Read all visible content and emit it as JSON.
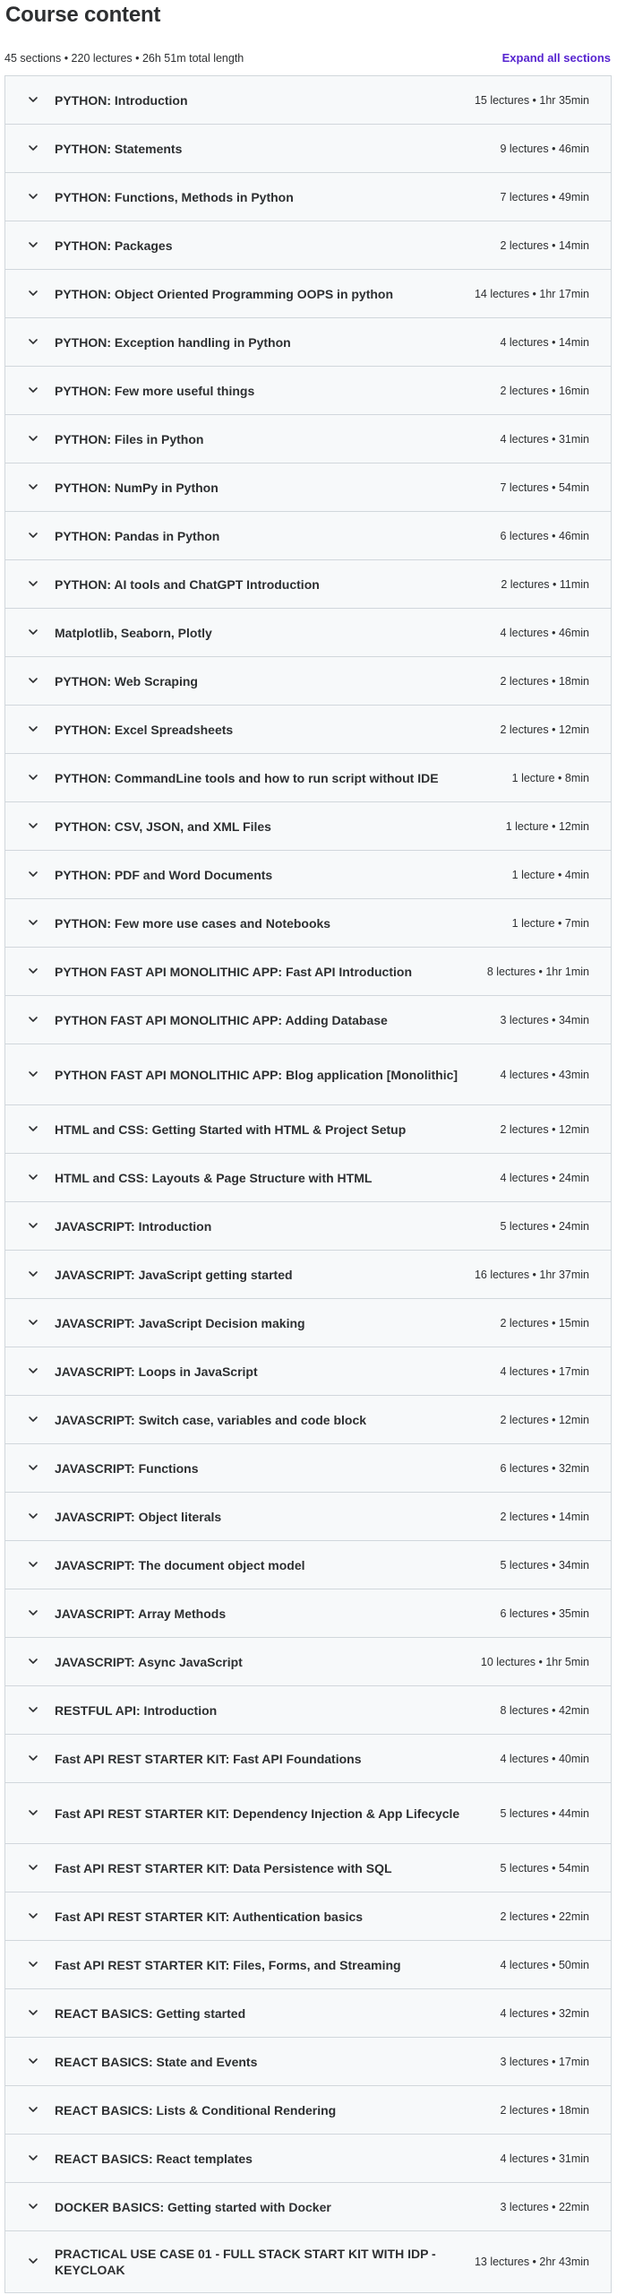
{
  "header": {
    "title": "Course content",
    "summary": "45 sections • 220 lectures • 26h 51m total length",
    "expand_label": "Expand all sections"
  },
  "sections": [
    {
      "title": "PYTHON: Introduction",
      "meta": "15 lectures • 1hr 35min"
    },
    {
      "title": "PYTHON: Statements",
      "meta": "9 lectures • 46min"
    },
    {
      "title": "PYTHON: Functions, Methods in Python",
      "meta": "7 lectures • 49min"
    },
    {
      "title": "PYTHON: Packages",
      "meta": "2 lectures • 14min"
    },
    {
      "title": "PYTHON: Object Oriented Programming OOPS in python",
      "meta": "14 lectures • 1hr 17min"
    },
    {
      "title": "PYTHON: Exception handling in Python",
      "meta": "4 lectures • 14min"
    },
    {
      "title": "PYTHON: Few more useful things",
      "meta": "2 lectures • 16min"
    },
    {
      "title": "PYTHON: Files in Python",
      "meta": "4 lectures • 31min"
    },
    {
      "title": "PYTHON: NumPy in Python",
      "meta": "7 lectures • 54min"
    },
    {
      "title": "PYTHON: Pandas in Python",
      "meta": "6 lectures • 46min"
    },
    {
      "title": "PYTHON: AI tools and ChatGPT Introduction",
      "meta": "2 lectures • 11min"
    },
    {
      "title": "Matplotlib, Seaborn, Plotly",
      "meta": "4 lectures • 46min"
    },
    {
      "title": "PYTHON: Web Scraping",
      "meta": "2 lectures • 18min"
    },
    {
      "title": "PYTHON: Excel Spreadsheets",
      "meta": "2 lectures • 12min"
    },
    {
      "title": "PYTHON: CommandLine tools and how to run script without IDE",
      "meta": "1 lecture • 8min"
    },
    {
      "title": "PYTHON: CSV, JSON, and XML Files",
      "meta": "1 lecture • 12min"
    },
    {
      "title": "PYTHON: PDF and Word Documents",
      "meta": "1 lecture • 4min"
    },
    {
      "title": "PYTHON: Few more use cases and Notebooks",
      "meta": "1 lecture • 7min"
    },
    {
      "title": "PYTHON FAST API MONOLITHIC APP: Fast API Introduction",
      "meta": "8 lectures • 1hr 1min"
    },
    {
      "title": "PYTHON FAST API MONOLITHIC APP: Adding Database",
      "meta": "3 lectures • 34min"
    },
    {
      "title": "PYTHON FAST API MONOLITHIC APP: Blog application [Monolithic]",
      "meta": "4 lectures • 43min"
    },
    {
      "title": "HTML and CSS: Getting Started with HTML & Project Setup",
      "meta": "2 lectures • 12min"
    },
    {
      "title": "HTML and CSS: Layouts & Page Structure with HTML",
      "meta": "4 lectures • 24min"
    },
    {
      "title": "JAVASCRIPT: Introduction",
      "meta": "5 lectures • 24min"
    },
    {
      "title": "JAVASCRIPT: JavaScript getting started",
      "meta": "16 lectures • 1hr 37min"
    },
    {
      "title": "JAVASCRIPT: JavaScript Decision making",
      "meta": "2 lectures • 15min"
    },
    {
      "title": "JAVASCRIPT: Loops in JavaScript",
      "meta": "4 lectures • 17min"
    },
    {
      "title": "JAVASCRIPT: Switch case, variables and code block",
      "meta": "2 lectures • 12min"
    },
    {
      "title": "JAVASCRIPT: Functions",
      "meta": "6 lectures • 32min"
    },
    {
      "title": "JAVASCRIPT: Object literals",
      "meta": "2 lectures • 14min"
    },
    {
      "title": "JAVASCRIPT: The document object model",
      "meta": "5 lectures • 34min"
    },
    {
      "title": "JAVASCRIPT: Array Methods",
      "meta": "6 lectures • 35min"
    },
    {
      "title": "JAVASCRIPT: Async JavaScript",
      "meta": "10 lectures • 1hr 5min"
    },
    {
      "title": "RESTFUL API: Introduction",
      "meta": "8 lectures • 42min"
    },
    {
      "title": "Fast API REST STARTER KIT: Fast API Foundations",
      "meta": "4 lectures • 40min"
    },
    {
      "title": "Fast API REST STARTER KIT: Dependency Injection & App Lifecycle",
      "meta": "5 lectures • 44min"
    },
    {
      "title": "Fast API REST STARTER KIT: Data Persistence with SQL",
      "meta": "5 lectures • 54min"
    },
    {
      "title": "Fast API REST STARTER KIT: Authentication basics",
      "meta": "2 lectures • 22min"
    },
    {
      "title": "Fast API REST STARTER KIT: Files, Forms, and Streaming",
      "meta": "4 lectures • 50min"
    },
    {
      "title": "REACT BASICS: Getting started",
      "meta": "4 lectures • 32min"
    },
    {
      "title": "REACT BASICS: State and Events",
      "meta": "3 lectures • 17min"
    },
    {
      "title": "REACT BASICS: Lists & Conditional Rendering",
      "meta": "2 lectures • 18min"
    },
    {
      "title": "REACT BASICS: React templates",
      "meta": "4 lectures • 31min"
    },
    {
      "title": "DOCKER BASICS: Getting started with Docker",
      "meta": "3 lectures • 22min"
    },
    {
      "title": "PRACTICAL USE CASE 01 - FULL STACK START KIT WITH IDP - KEYCLOAK",
      "meta": "13 lectures • 2hr 43min"
    }
  ],
  "icons": {
    "section_toggle": "chevron-down-icon"
  },
  "colors": {
    "accent": "#5624d0",
    "row_bg": "#f7f9fa",
    "border": "#d1d7dc",
    "text": "#2d2f31"
  }
}
